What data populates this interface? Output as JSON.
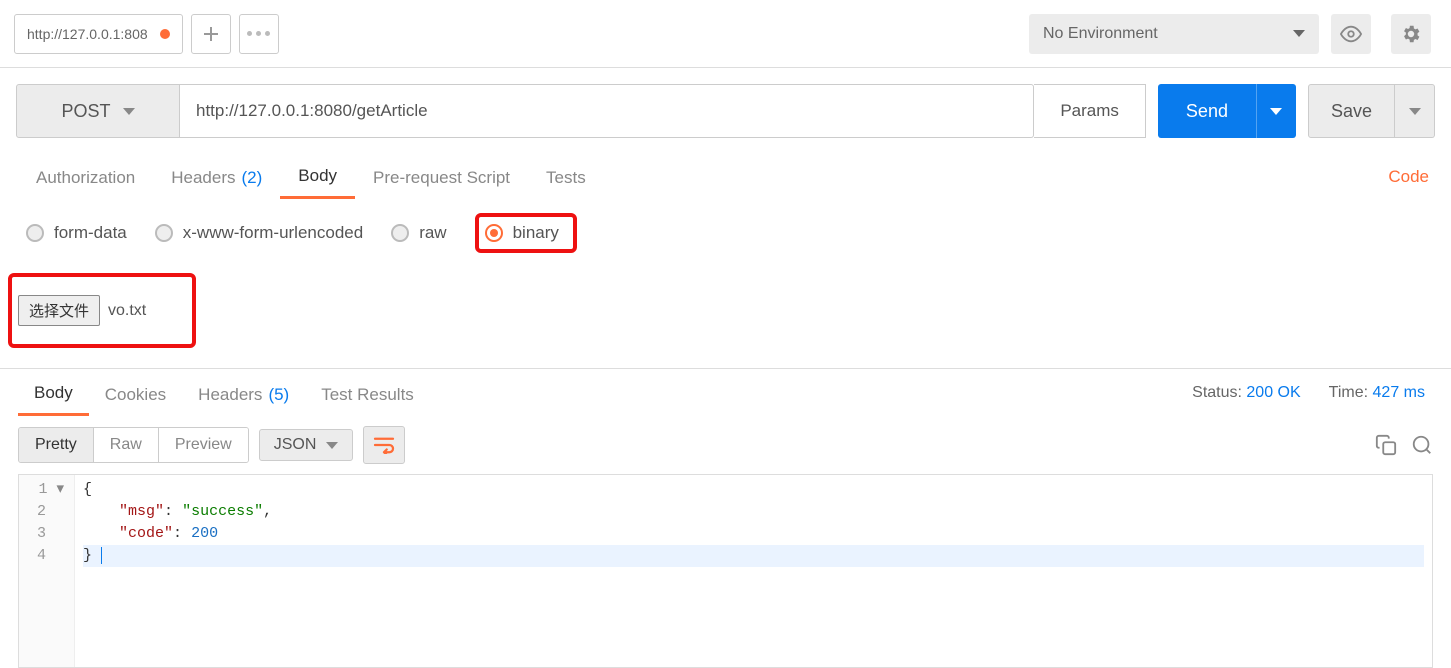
{
  "topbar": {
    "tab_label": "http://127.0.0.1:808",
    "env_label": "No Environment"
  },
  "request": {
    "method": "POST",
    "url": "http://127.0.0.1:8080/getArticle",
    "params_label": "Params",
    "send_label": "Send",
    "save_label": "Save"
  },
  "request_tabs": {
    "auth": "Authorization",
    "headers": "Headers",
    "headers_count": "(2)",
    "body": "Body",
    "prereq": "Pre-request Script",
    "tests": "Tests",
    "code": "Code"
  },
  "body_types": {
    "formdata": "form-data",
    "xwww": "x-www-form-urlencoded",
    "raw": "raw",
    "binary": "binary"
  },
  "file": {
    "choose_label": "选择文件",
    "filename": "vo.txt"
  },
  "response_tabs": {
    "body": "Body",
    "cookies": "Cookies",
    "headers": "Headers",
    "headers_count": "(5)",
    "tests": "Test Results"
  },
  "response_meta": {
    "status_label": "Status:",
    "status_value": "200 OK",
    "time_label": "Time:",
    "time_value": "427 ms"
  },
  "viewer": {
    "pretty": "Pretty",
    "raw": "Raw",
    "preview": "Preview",
    "lang": "JSON"
  },
  "code_lines": {
    "l1": "{",
    "l2_key": "\"msg\"",
    "l2_val": "\"success\"",
    "l3_key": "\"code\"",
    "l3_val": "200",
    "l4": "}"
  }
}
